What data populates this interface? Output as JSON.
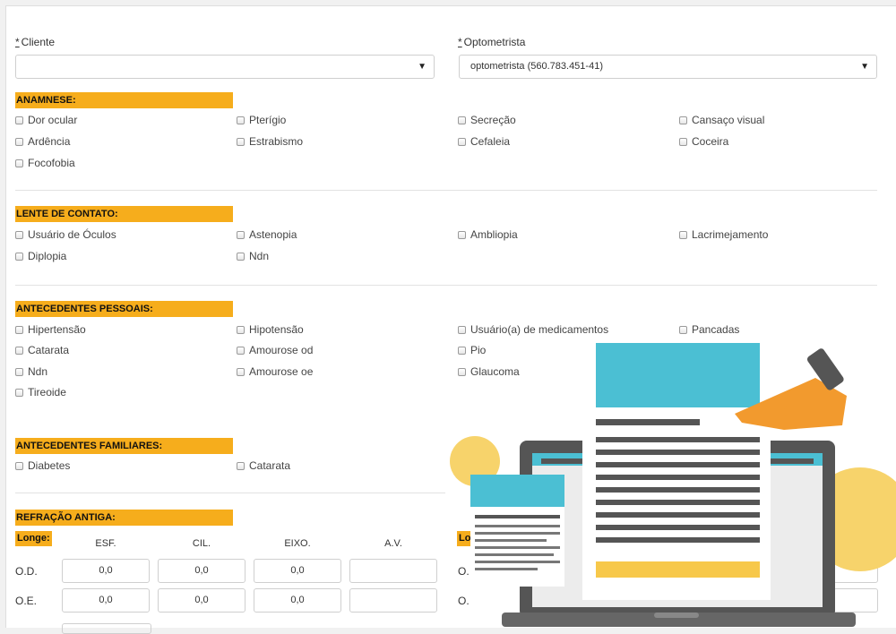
{
  "form": {
    "cliente_label": "Cliente",
    "cliente_value": "",
    "optometrista_label": "Optometrista",
    "optometrista_value": "optometrista (560.783.451-41)",
    "required_mark": "*"
  },
  "anamnese": {
    "title": "ANAMNESE:",
    "items": [
      "Dor ocular",
      "Pterígio",
      "Secreção",
      "Cansaço visual",
      "Ardência",
      "Estrabismo",
      "Cefaleia",
      "Coceira",
      "Focofobia"
    ]
  },
  "lente": {
    "title": "LENTE DE CONTATO:",
    "items": [
      "Usuário de Óculos",
      "Astenopia",
      "Ambliopia",
      "Lacrimejamento",
      "Diplopia",
      "Ndn"
    ]
  },
  "pessoais": {
    "title": "ANTECEDENTES PESSOAIS:",
    "items": [
      "Hipertensão",
      "Hipotensão",
      "Usuário(a) de medicamentos",
      "Pancadas",
      "Catarata",
      "Amourose od",
      "Pio",
      "Ndn",
      "Amourose oe",
      "Glaucoma",
      "Tireoide"
    ]
  },
  "familiares": {
    "title": "ANTECEDENTES FAMILIARES:",
    "items": [
      "Diabetes",
      "Catarata"
    ]
  },
  "refracao": {
    "title": "REFRAÇÃO ANTIGA:",
    "longe_label": "Longe:",
    "longe_label_right": "Lo",
    "columns": [
      "ESF.",
      "CIL.",
      "EIXO.",
      "A.V."
    ],
    "rows": [
      {
        "label": "O.D.",
        "values": [
          "0,0",
          "0,0",
          "0,0",
          ""
        ],
        "right_label": "O."
      },
      {
        "label": "O.E.",
        "values": [
          "0,0",
          "0,0",
          "0,0",
          ""
        ],
        "right_label": "O."
      }
    ]
  },
  "illustration": {
    "icons": [
      "laptop-icon",
      "document-icon",
      "pointing-hand-icon"
    ],
    "colors": {
      "teal": "#4bbfd3",
      "orange": "#f29a2e",
      "yellow": "#f7d36b",
      "dark": "#555555"
    }
  }
}
